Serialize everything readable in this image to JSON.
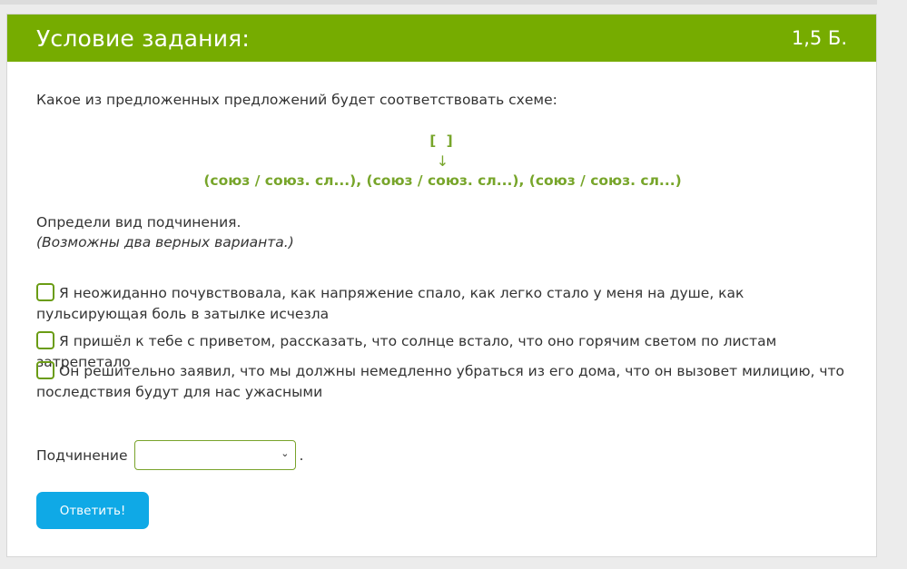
{
  "header": {
    "title": "Условие задания:",
    "points": "1,5 Б."
  },
  "question": "Какое из предложенных предложений будет соответствовать схеме:",
  "scheme": {
    "main_clause": "[ ]",
    "arrow": "↓",
    "sub_clauses": "(союз / союз. сл...), (союз / союз. сл...), (союз / союз. сл...)"
  },
  "instruction": {
    "text": "Определи вид подчинения.",
    "hint": "(Возможны два верных варианта.)"
  },
  "options": [
    {
      "label": "Я неожиданно почувствовала, как напряжение спало, как легко стало у меня на душе, как пульсирующая боль в затылке исчезла",
      "checked": false
    },
    {
      "label": "Я пришёл к тебе с приветом, рассказать, что солнце встало, что оно горячим светом по листам затрепетало",
      "checked": false
    },
    {
      "label": "Он решительно заявил, что мы должны немедленно убраться из его дома, что он вызовет милицию, что последствия будут для нас ужасными",
      "checked": false
    }
  ],
  "subordination": {
    "label": "Подчинение",
    "selected_value": "",
    "trailing": "."
  },
  "submit_label": "Ответить!",
  "colors": {
    "header_bg": "#76ac00",
    "accent_green": "#77a52a",
    "button_bg": "#0fa9e6"
  }
}
